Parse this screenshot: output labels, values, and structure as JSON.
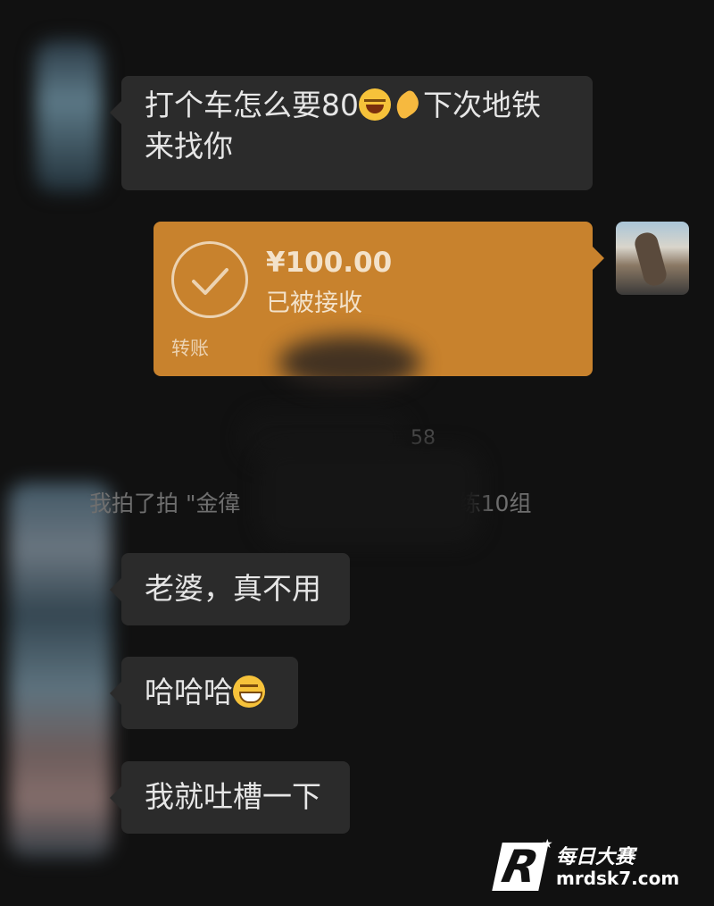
{
  "messages": {
    "first": {
      "text_a": "打个车怎么要80",
      "text_b": "下次地铁来找你",
      "emojis": [
        "laughing-crying",
        "ok-hand"
      ]
    },
    "transfer": {
      "amount": "¥100.00",
      "status": "已被接收",
      "label": "转账"
    },
    "system": {
      "time_fragment": "58",
      "pat_prefix": "我拍了拍 \"金徫",
      "pat_suffix": "所)\" 说再练10组"
    },
    "m2": "老婆，真不用",
    "m3": {
      "text": "哈哈哈",
      "emoji": "grinning"
    },
    "m4": "我就吐槽一下"
  },
  "watermark": {
    "brand_cn": "每日大赛",
    "domain": "mrdsk7.com",
    "logo_letter": "R"
  },
  "colors": {
    "background": "#111111",
    "bubble": "#2b2b2b",
    "transfer": "#c8822d"
  }
}
